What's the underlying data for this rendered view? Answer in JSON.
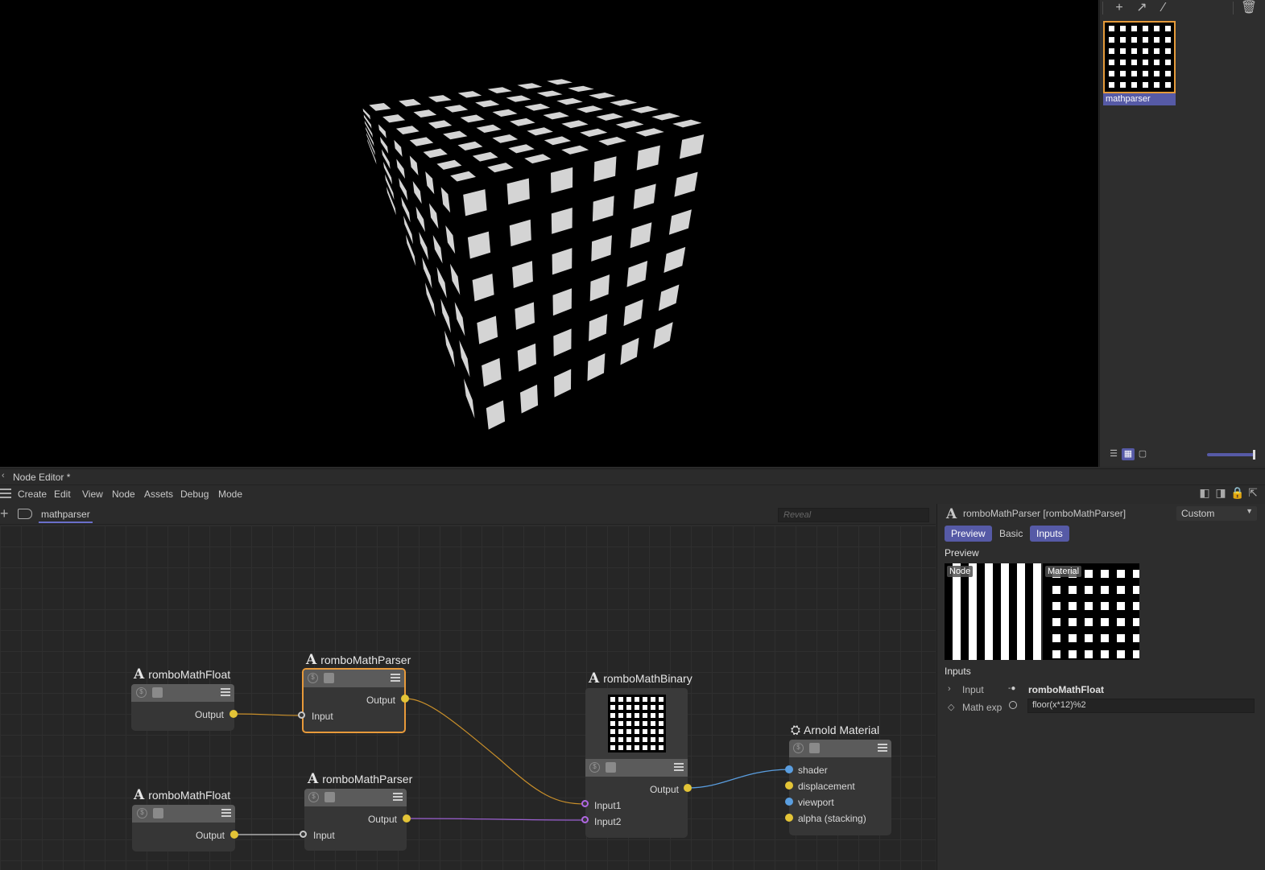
{
  "material_panel": {
    "toolbar_icons": [
      "plus-icon",
      "arrow-up-right-icon",
      "eyedropper-icon",
      "trash-icon"
    ],
    "material_name": "mathparser",
    "view_icons": [
      "list-view-icon",
      "grid-view-icon",
      "single-view-icon"
    ]
  },
  "node_editor": {
    "title": "Node Editor *",
    "menu": [
      "Create",
      "Edit",
      "View",
      "Node",
      "Assets",
      "Debug",
      "Mode"
    ],
    "tab": "mathparser",
    "reveal_placeholder": "Reveal"
  },
  "nodes": {
    "float1": {
      "icon": "A",
      "title": "romboMathFloat",
      "output": "Output"
    },
    "parser1": {
      "icon": "A",
      "title": "romboMathParser",
      "output": "Output",
      "input": "Input"
    },
    "float2": {
      "icon": "A",
      "title": "romboMathFloat",
      "output": "Output"
    },
    "parser2": {
      "icon": "A",
      "title": "romboMathParser",
      "output": "Output",
      "input": "Input"
    },
    "binary": {
      "icon": "A",
      "title": "romboMathBinary",
      "output": "Output",
      "input1": "Input1",
      "input2": "Input2"
    },
    "material": {
      "title": "Arnold Material",
      "ports": [
        "shader",
        "displacement",
        "viewport",
        "alpha (stacking)"
      ]
    }
  },
  "attributes": {
    "icon": "A",
    "title": "romboMathParser [romboMathParser]",
    "mode": "Custom",
    "tabs": [
      "Preview",
      "Basic",
      "Inputs"
    ],
    "preview_heading": "Preview",
    "preview_tags": [
      "Node",
      "Material"
    ],
    "inputs_heading": "Inputs",
    "input_label": "Input",
    "input_value": "romboMathFloat",
    "mathexp_label": "Math exp",
    "mathexp_value": "floor(x*12)%2"
  },
  "colors": {
    "accent": "#565aa6",
    "selection": "#e89a3a",
    "port_yellow": "#e3c437",
    "port_blue": "#5a9ee0",
    "port_purple": "#b067e3"
  }
}
